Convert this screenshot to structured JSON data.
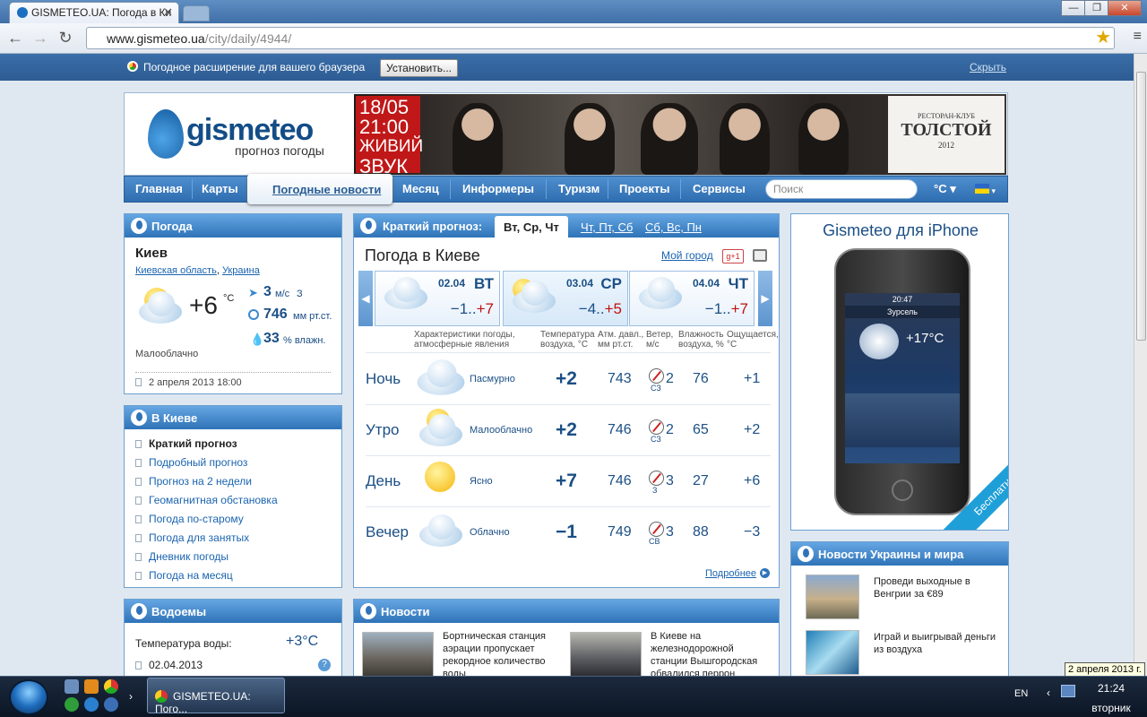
{
  "browser": {
    "tab_title": "GISMETEO.UA: Погода в Ки",
    "url_host": "www.gismeteo.ua",
    "url_path": "/city/daily/4944/"
  },
  "extension_bar": {
    "text": "Погодное расширение для вашего браузера",
    "install_label": "Установить...",
    "hide_label": "Скрыть"
  },
  "header": {
    "logo": "gismeteo",
    "logo_sub": "прогноз погоды",
    "banner": {
      "date": "18/05",
      "time": "21:00",
      "line1": "ЖИВИЙ",
      "line2": "ЗВУК",
      "club_top": "РЕСТОРАН-КЛУБ",
      "club_name": "ТОЛСТОЙ",
      "club_year": "2012"
    }
  },
  "nav": {
    "items": [
      "Главная",
      "Карты",
      "Погодные новости",
      "Месяц",
      "Информеры",
      "Туризм",
      "Проекты",
      "Сервисы"
    ],
    "search_placeholder": "Поиск",
    "unit": "°C"
  },
  "weather_panel": {
    "title": "Погода",
    "city": "Киев",
    "region": "Киевская область",
    "country": "Украина",
    "temp": "+6",
    "temp_unit": "°C",
    "wind_value": "3",
    "wind_unit": "м/с",
    "wind_dir": "З",
    "pressure_value": "746",
    "pressure_unit": "мм рт.ст.",
    "humidity_value": "33",
    "humidity_unit": "% влажн.",
    "description": "Малооблачно",
    "timestamp": "2 апреля 2013 18:00"
  },
  "kiev_panel": {
    "title": "В Киеве",
    "links": [
      "Краткий прогноз",
      "Подробный прогноз",
      "Прогноз на 2 недели",
      "Геомагнитная обстановка",
      "Погода по-старому",
      "Погода для занятых",
      "Дневник погоды",
      "Погода на месяц"
    ]
  },
  "water_panel": {
    "title": "Водоемы",
    "label": "Температура воды:",
    "value": "+3°C",
    "date": "02.04.2013"
  },
  "forecast": {
    "title": "Краткий прогноз:",
    "tabs": [
      "Вт, Ср, Чт",
      "Чт, Пт, Сб",
      "Сб, Вс, Пн"
    ],
    "city_title": "Погода в Киеве",
    "my_city": "Мой город",
    "gplus": "+1",
    "days": [
      {
        "date": "02.04",
        "name": "ВТ",
        "min": "−1..",
        "max": "+7"
      },
      {
        "date": "03.04",
        "name": "СР",
        "min": "−4..",
        "max": "+5"
      },
      {
        "date": "04.04",
        "name": "ЧТ",
        "min": "−1..",
        "max": "+7"
      }
    ],
    "columns": [
      "Характеристики погоды, атмосферные явления",
      "Температура воздуха, °C",
      "Атм. давл., мм рт.ст.",
      "Ветер, м/с",
      "Влажность воздуха, %",
      "Ощущается, °C"
    ],
    "rows": [
      {
        "label": "Ночь",
        "desc": "Пасмурно",
        "temp": "+2",
        "pressure": "743",
        "wind": "2",
        "wind_dir": "СЗ",
        "humidity": "76",
        "feels": "+1"
      },
      {
        "label": "Утро",
        "desc": "Малооблачно",
        "temp": "+2",
        "pressure": "746",
        "wind": "2",
        "wind_dir": "СЗ",
        "humidity": "65",
        "feels": "+2"
      },
      {
        "label": "День",
        "desc": "Ясно",
        "temp": "+7",
        "pressure": "746",
        "wind": "3",
        "wind_dir": "З",
        "humidity": "27",
        "feels": "+6"
      },
      {
        "label": "Вечер",
        "desc": "Облачно",
        "temp": "−1",
        "pressure": "749",
        "wind": "3",
        "wind_dir": "СВ",
        "humidity": "88",
        "feels": "−3"
      }
    ],
    "more": "Подробнее"
  },
  "news_panel": {
    "title": "Новости",
    "items": [
      "Бортническая станция аэрации пропускает рекордное количество воды",
      "В Киеве на железнодорожной станции Вышгородская обвалился перрон"
    ]
  },
  "iphone_panel": {
    "title": "Gismeteo для iPhone",
    "free": "Бесплатно",
    "screen_time": "20:47",
    "screen_city": "Зурсель",
    "screen_temp": "+17°C"
  },
  "world_panel": {
    "title": "Новости Украины и мира",
    "items": [
      "Проведи выходные в Венгрии за €89",
      "Играй и выигрывай деньги из воздуха"
    ]
  },
  "taskbar": {
    "app_label": "GISMETEO.UA: Пого...",
    "lang": "EN",
    "time": "21:24",
    "day": "вторник",
    "tooltip": "2 апреля 2013 г."
  }
}
